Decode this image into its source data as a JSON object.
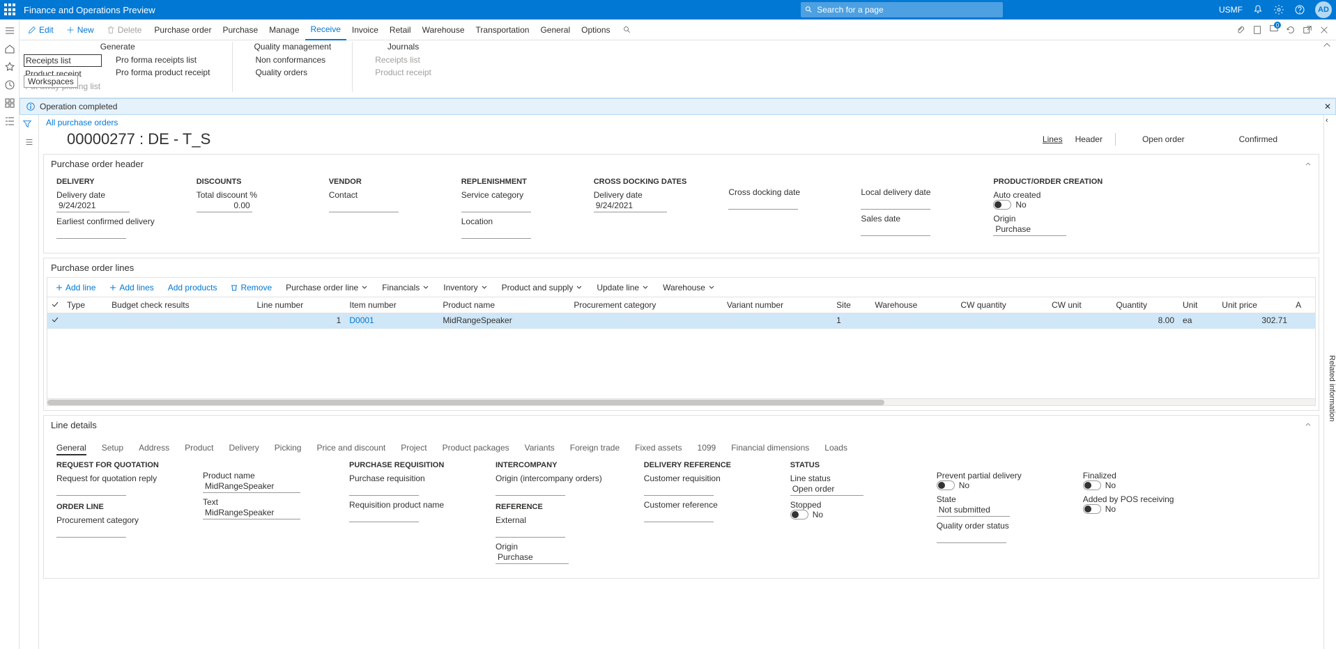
{
  "topbar": {
    "title": "Finance and Operations Preview",
    "search_placeholder": "Search for a page",
    "company": "USMF",
    "avatar": "AD"
  },
  "actions": {
    "edit": "Edit",
    "new": "New",
    "delete": "Delete",
    "tabs": [
      "Purchase order",
      "Purchase",
      "Manage",
      "Receive",
      "Invoice",
      "Retail",
      "Warehouse",
      "Transportation",
      "General",
      "Options"
    ],
    "active_tab_index": 3,
    "msg_count": "0"
  },
  "ribbon": {
    "generate": {
      "title": "Generate",
      "col1": [
        "Receipts list",
        "Product receipt",
        "Put away picking list"
      ],
      "col2": [
        "Pro forma receipts list",
        "Pro forma product receipt"
      ]
    },
    "quality": {
      "title": "Quality management",
      "col1": [
        "Non conformances",
        "Quality orders"
      ]
    },
    "journals": {
      "title": "Journals",
      "col1": [
        "Receipts list",
        "Product receipt"
      ]
    },
    "tooltip": "Workspaces"
  },
  "notif": {
    "text": "Operation completed"
  },
  "crumb": "All purchase orders",
  "page_title": "00000277 : DE - T_S",
  "page_tabs": {
    "lines": "Lines",
    "header": "Header",
    "open": "Open order",
    "approval": "Confirmed"
  },
  "po_header": {
    "title": "Purchase order header",
    "delivery": {
      "hdr": "DELIVERY",
      "delivery_date_lbl": "Delivery date",
      "delivery_date": "9/24/2021",
      "earliest_lbl": "Earliest confirmed delivery"
    },
    "discounts": {
      "hdr": "DISCOUNTS",
      "total_lbl": "Total discount %",
      "total_val": "0.00"
    },
    "vendor": {
      "hdr": "VENDOR",
      "contact_lbl": "Contact"
    },
    "replen": {
      "hdr": "REPLENISHMENT",
      "svc_lbl": "Service category",
      "loc_lbl": "Location"
    },
    "crossdock": {
      "hdr": "CROSS DOCKING DATES",
      "dd_lbl": "Delivery date",
      "dd_val": "9/24/2021",
      "cdd_lbl": "Cross docking date",
      "ldd_lbl": "Local delivery date",
      "sd_lbl": "Sales date"
    },
    "prodorder": {
      "hdr": "PRODUCT/ORDER CREATION",
      "auto_lbl": "Auto created",
      "auto_val": "No",
      "origin_lbl": "Origin",
      "origin_val": "Purchase"
    }
  },
  "po_lines": {
    "title": "Purchase order lines",
    "bar": {
      "add": "Add line",
      "adds": "Add lines",
      "addp": "Add products",
      "remove": "Remove",
      "pol": "Purchase order line",
      "fin": "Financials",
      "inv": "Inventory",
      "ps": "Product and supply",
      "upd": "Update line",
      "wh": "Warehouse"
    },
    "cols": [
      "Type",
      "Budget check results",
      "Line number",
      "Item number",
      "Product name",
      "Procurement category",
      "Variant number",
      "Site",
      "Warehouse",
      "CW quantity",
      "CW unit",
      "Quantity",
      "Unit",
      "Unit price",
      "A"
    ],
    "row": {
      "line_number": "1",
      "item": "D0001",
      "product": "MidRangeSpeaker",
      "site": "1",
      "qty": "8.00",
      "unit": "ea",
      "price": "302.71"
    }
  },
  "line_details": {
    "title": "Line details",
    "tabs": [
      "General",
      "Setup",
      "Address",
      "Product",
      "Delivery",
      "Picking",
      "Price and discount",
      "Project",
      "Product packages",
      "Variants",
      "Foreign trade",
      "Fixed assets",
      "1099",
      "Financial dimensions",
      "Loads"
    ],
    "rfq": {
      "hdr": "REQUEST FOR QUOTATION",
      "reply_lbl": "Request for quotation reply",
      "ol_hdr": "ORDER LINE",
      "pc_lbl": "Procurement category"
    },
    "prodname_lbl": "Product name",
    "prodname_val": "MidRangeSpeaker",
    "text_lbl": "Text",
    "text_val": "MidRangeSpeaker",
    "pr": {
      "hdr": "PURCHASE REQUISITION",
      "pr_lbl": "Purchase requisition",
      "rpn_lbl": "Requisition product name"
    },
    "ic": {
      "hdr": "INTERCOMPANY",
      "orig_lbl": "Origin (intercompany orders)",
      "ref_hdr": "REFERENCE",
      "ext_lbl": "External",
      "origin_lbl": "Origin",
      "origin_val": "Purchase"
    },
    "delref": {
      "hdr": "DELIVERY REFERENCE",
      "cr_lbl": "Customer requisition",
      "cref_lbl": "Customer reference"
    },
    "status": {
      "hdr": "STATUS",
      "ls_lbl": "Line status",
      "ls_val": "Open order",
      "stop_lbl": "Stopped",
      "stop_val": "No",
      "state_lbl": "State",
      "state_val": "Not submitted",
      "qos_lbl": "Quality order status"
    },
    "flags": {
      "ppd_lbl": "Prevent partial delivery",
      "ppd_val": "No",
      "fin_lbl": "Finalized",
      "fin_val": "No",
      "pos_lbl": "Added by POS receiving",
      "pos_val": "No"
    }
  },
  "rightstrip": "Related information"
}
